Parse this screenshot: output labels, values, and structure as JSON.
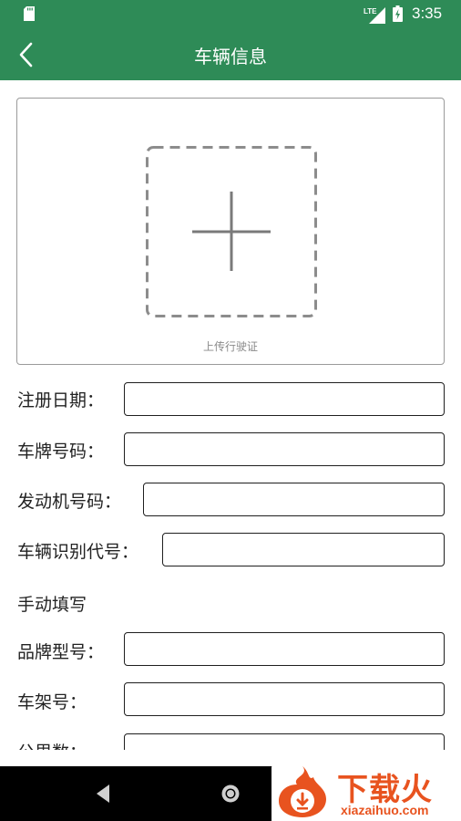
{
  "status_bar": {
    "time": "3:35",
    "network": "LTE",
    "icons": [
      "sd-card-icon",
      "lte-signal-icon",
      "battery-charging-icon"
    ]
  },
  "app_bar": {
    "title": "车辆信息",
    "back_icon": "chevron-left-icon"
  },
  "upload": {
    "label": "上传行驶证",
    "icon": "plus-icon"
  },
  "form": {
    "registration_date": {
      "label": "注册日期：",
      "value": ""
    },
    "plate_number": {
      "label": "车牌号码：",
      "value": ""
    },
    "engine_number": {
      "label": "发动机号码：",
      "value": ""
    },
    "vin": {
      "label": "车辆识别代号：",
      "value": ""
    },
    "manual_section": "手动填写",
    "brand_model": {
      "label": "品牌型号：",
      "value": ""
    },
    "frame_number": {
      "label": "车架号：",
      "value": ""
    },
    "mileage": {
      "label": "公里数：",
      "value": ""
    }
  },
  "nav_bar": {
    "icons": [
      "nav-back-icon",
      "nav-home-icon"
    ]
  },
  "watermark": {
    "text_cn": "下载火",
    "text_en": "xiazaihuo.com"
  },
  "colors": {
    "primary": "#2e8b57",
    "watermark": "#e8531f"
  }
}
